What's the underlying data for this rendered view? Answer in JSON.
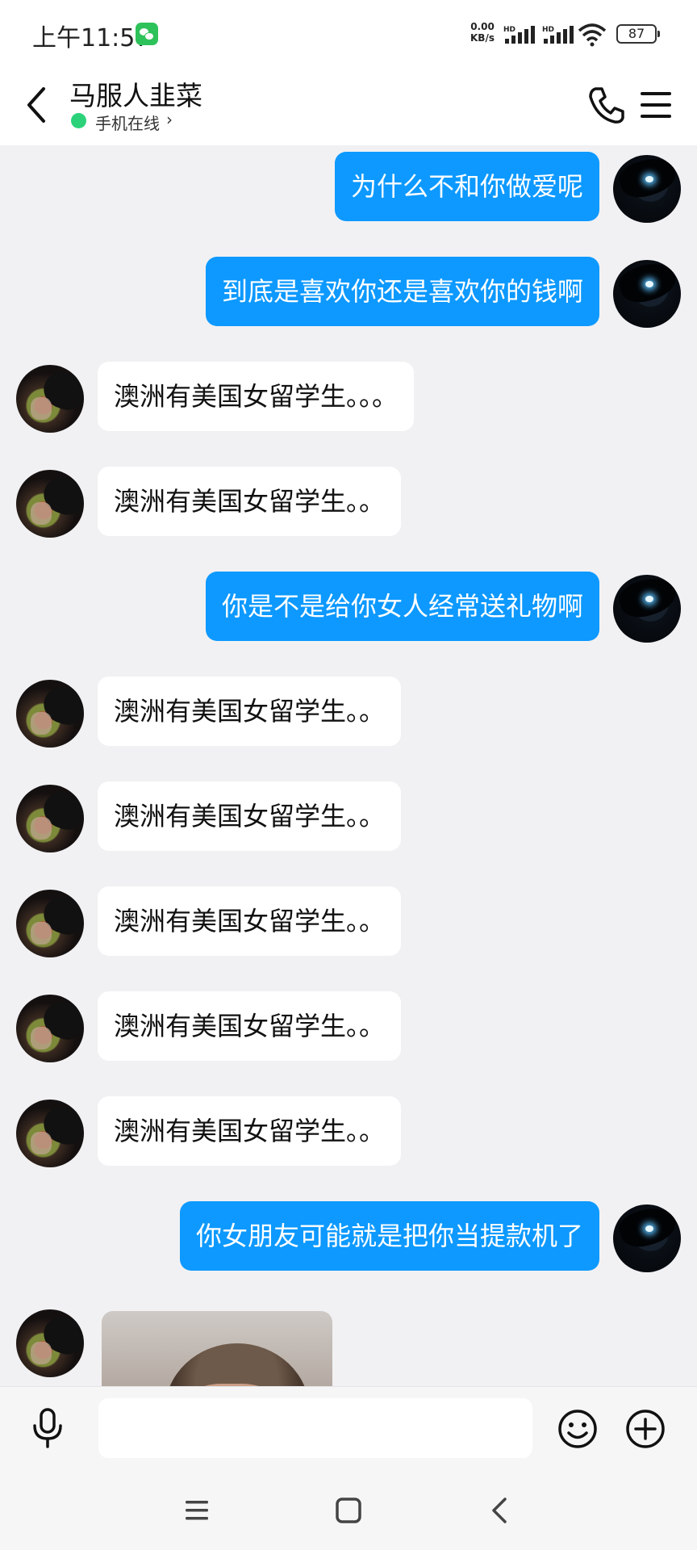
{
  "status_bar": {
    "time": "上午11:57",
    "net_speed_value": "0.00",
    "net_speed_unit": "KB/s",
    "signal1_tag": "HD",
    "signal2_tag": "HD",
    "battery": "87"
  },
  "header": {
    "title": "马服人韭菜",
    "status": "手机在线",
    "status_chevron": "›"
  },
  "messages": [
    {
      "side": "out",
      "text": "为什么不和你做爱呢"
    },
    {
      "side": "out",
      "text": "到底是喜欢你还是喜欢你的钱啊"
    },
    {
      "side": "in",
      "text": "澳洲有美国女留学生。。。"
    },
    {
      "side": "in",
      "text": "澳洲有美国女留学生。。"
    },
    {
      "side": "out",
      "text": "你是不是给你女人经常送礼物啊"
    },
    {
      "side": "in",
      "text": "澳洲有美国女留学生。。"
    },
    {
      "side": "in",
      "text": "澳洲有美国女留学生。。"
    },
    {
      "side": "in",
      "text": "澳洲有美国女留学生。。"
    },
    {
      "side": "in",
      "text": "澳洲有美国女留学生。。"
    },
    {
      "side": "in",
      "text": "澳洲有美国女留学生。。"
    },
    {
      "side": "out",
      "text": "你女朋友可能就是把你当提款机了"
    },
    {
      "side": "in",
      "type": "image"
    }
  ],
  "input": {
    "value": "",
    "placeholder": ""
  },
  "icons": {
    "back": "back-chevron-icon",
    "phone": "phone-icon",
    "menu": "hamburger-menu-icon",
    "mic": "microphone-icon",
    "emoji": "smiley-icon",
    "plus": "plus-circle-icon",
    "nav_menu": "recent-apps-icon",
    "nav_home": "home-square-icon",
    "nav_back": "nav-back-icon"
  },
  "colors": {
    "outgoing_bubble": "#0d99ff",
    "incoming_bubble": "#ffffff",
    "chat_background": "#f1f1f3",
    "online_dot": "#2bd27a"
  }
}
